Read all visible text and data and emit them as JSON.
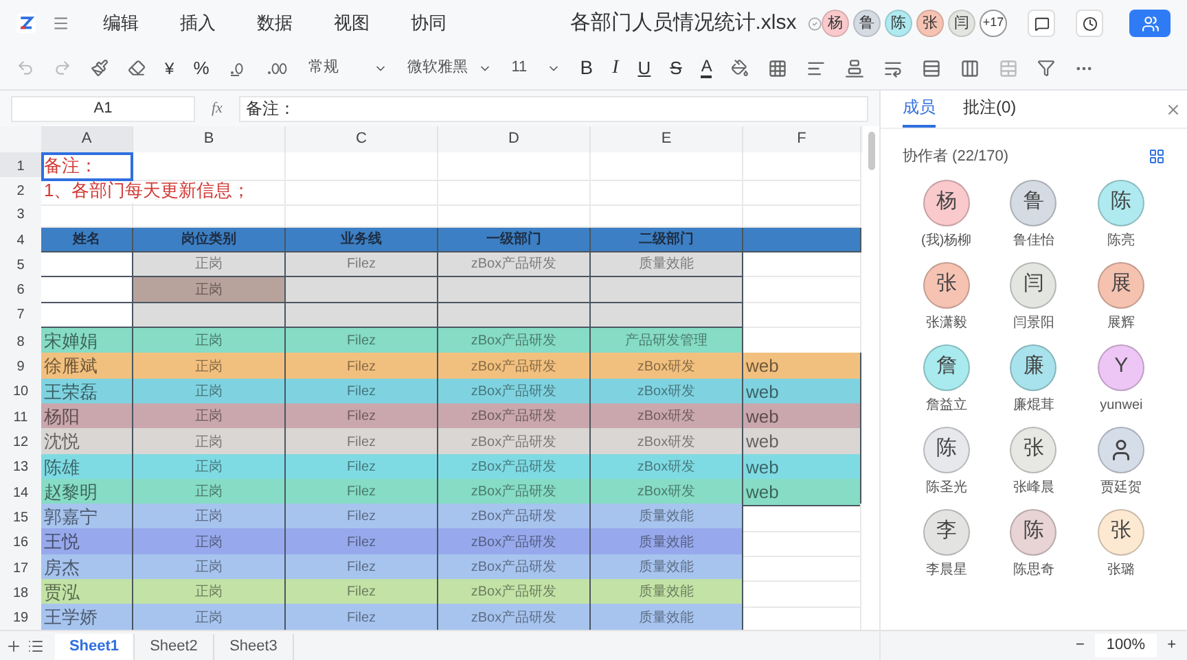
{
  "menu": [
    "编辑",
    "插入",
    "数据",
    "视图",
    "协同"
  ],
  "title": "各部门人员情况统计.xlsx",
  "top_avatars": [
    {
      "char": "杨",
      "color": "#f9c9cc"
    },
    {
      "char": "鲁",
      "color": "#d5dbe3"
    },
    {
      "char": "陈",
      "color": "#aeeaf0"
    },
    {
      "char": "张",
      "color": "#f6c3b3"
    },
    {
      "char": "闫",
      "color": "#e3e5e1"
    }
  ],
  "more_count": "+17",
  "toolbar": {
    "currency": "¥",
    "percent": "%",
    "number_format": "常规",
    "font": "微软雅黑",
    "size": "11",
    "bold": "B",
    "italic": "I",
    "underline": "U",
    "strike": "S",
    "font_color": "A"
  },
  "formula_bar": {
    "cell": "A1",
    "fx": "fx",
    "value": "备注："
  },
  "columns": [
    "A",
    "B",
    "C",
    "D",
    "E",
    "F"
  ],
  "rows": [
    {
      "number": "1",
      "kind": "note",
      "cells": [
        {
          "text": "备注：",
          "selected": true
        },
        {},
        {},
        {},
        {},
        {}
      ]
    },
    {
      "number": "2",
      "kind": "note",
      "cells": [
        {
          "text": "1、各部门每天更新信息；",
          "selected": false
        },
        {},
        {},
        {},
        {}
      ]
    },
    {
      "number": "3",
      "kind": "blank",
      "cells": [
        {},
        {},
        {},
        {},
        {},
        {}
      ]
    },
    {
      "number": "4",
      "kind": "header",
      "cells": [
        {
          "text": "姓名",
          "color": "#3d7fc4"
        },
        {
          "text": "岗位类别",
          "color": "#3d7fc4"
        },
        {
          "text": "业务线",
          "color": "#3d7fc4"
        },
        {
          "text": "一级部门",
          "color": "#3d7fc4"
        },
        {
          "text": "二级部门",
          "color": "#3d7fc4"
        },
        {
          "color": "#3d7fc4"
        }
      ]
    },
    {
      "number": "5",
      "kind": "data",
      "cells": [
        {},
        {
          "text": "正岗",
          "color": "#dcdcdc"
        },
        {
          "text": "Filez",
          "color": "#dcdcdc"
        },
        {
          "text": "zBox产品研发",
          "color": "#dcdcdc"
        },
        {
          "text": "质量效能",
          "color": "#dcdcdc"
        },
        {}
      ]
    },
    {
      "number": "6",
      "kind": "data",
      "cells": [
        {},
        {
          "text": "正岗",
          "color": "#b8a39c"
        },
        {
          "color": "#dcdcdc"
        },
        {
          "color": "#dcdcdc"
        },
        {
          "color": "#dcdcdc"
        },
        {}
      ]
    },
    {
      "number": "7",
      "kind": "data",
      "cells": [
        {},
        {
          "color": "#dcdcdc"
        },
        {
          "color": "#dcdcdc"
        },
        {
          "color": "#dcdcdc"
        },
        {
          "color": "#dcdcdc"
        },
        {}
      ]
    },
    {
      "number": "8",
      "kind": "data",
      "cells": [
        {
          "text": "宋婵娟",
          "color": "#86dcc4"
        },
        {
          "text": "正岗",
          "color": "#86dcc4"
        },
        {
          "text": "Filez",
          "color": "#86dcc4"
        },
        {
          "text": "zBox产品研发",
          "color": "#86dcc4"
        },
        {
          "text": "产品研发管理",
          "color": "#86dcc4"
        },
        {}
      ]
    },
    {
      "number": "9",
      "kind": "data",
      "cells": [
        {
          "text": "徐雁斌",
          "color": "#f2c07e"
        },
        {
          "text": "正岗",
          "color": "#f2c07e"
        },
        {
          "text": "Filez",
          "color": "#f2c07e"
        },
        {
          "text": "zBox产品研发",
          "color": "#f2c07e"
        },
        {
          "text": "zBox研发",
          "color": "#f2c07e"
        },
        {
          "text": "web",
          "color": "#f2c07e"
        }
      ]
    },
    {
      "number": "10",
      "kind": "data",
      "cells": [
        {
          "text": "王荣磊",
          "color": "#7fd3e0"
        },
        {
          "text": "正岗",
          "color": "#7fd3e0"
        },
        {
          "text": "Filez",
          "color": "#7fd3e0"
        },
        {
          "text": "zBox产品研发",
          "color": "#7fd3e0"
        },
        {
          "text": "zBox研发",
          "color": "#7fd3e0"
        },
        {
          "text": "web",
          "color": "#7fd3e0"
        }
      ]
    },
    {
      "number": "11",
      "kind": "data",
      "cells": [
        {
          "text": "杨阳",
          "color": "#c9a7ad"
        },
        {
          "text": "正岗",
          "color": "#c9a7ad"
        },
        {
          "text": "Filez",
          "color": "#c9a7ad"
        },
        {
          "text": "zBox产品研发",
          "color": "#c9a7ad"
        },
        {
          "text": "zBox研发",
          "color": "#c9a7ad"
        },
        {
          "text": "web",
          "color": "#c9a7ad"
        }
      ]
    },
    {
      "number": "12",
      "kind": "data",
      "cells": [
        {
          "text": "沈悦",
          "color": "#d9d6d3"
        },
        {
          "text": "正岗",
          "color": "#d9d6d3"
        },
        {
          "text": "Filez",
          "color": "#d9d6d3"
        },
        {
          "text": "zBox产品研发",
          "color": "#d9d6d3"
        },
        {
          "text": "zBox研发",
          "color": "#d9d6d3"
        },
        {
          "text": "web",
          "color": "#d9d6d3"
        }
      ]
    },
    {
      "number": "13",
      "kind": "data",
      "cells": [
        {
          "text": "陈雄",
          "color": "#7fdbe3"
        },
        {
          "text": "正岗",
          "color": "#7fdbe3"
        },
        {
          "text": "Filez",
          "color": "#7fdbe3"
        },
        {
          "text": "zBox产品研发",
          "color": "#7fdbe3"
        },
        {
          "text": "zBox研发",
          "color": "#7fdbe3"
        },
        {
          "text": "web",
          "color": "#7fdbe3"
        }
      ]
    },
    {
      "number": "14",
      "kind": "data",
      "cells": [
        {
          "text": "赵黎明",
          "color": "#86dcc4"
        },
        {
          "text": "正岗",
          "color": "#86dcc4"
        },
        {
          "text": "Filez",
          "color": "#86dcc4"
        },
        {
          "text": "zBox产品研发",
          "color": "#86dcc4"
        },
        {
          "text": "zBox研发",
          "color": "#86dcc4"
        },
        {
          "text": "web",
          "color": "#86dcc4"
        }
      ]
    },
    {
      "number": "15",
      "kind": "data",
      "cells": [
        {
          "text": "郭嘉宁",
          "color": "#a7c4ef"
        },
        {
          "text": "正岗",
          "color": "#a7c4ef"
        },
        {
          "text": "Filez",
          "color": "#a7c4ef"
        },
        {
          "text": "zBox产品研发",
          "color": "#a7c4ef"
        },
        {
          "text": "质量效能",
          "color": "#a7c4ef"
        },
        {}
      ]
    },
    {
      "number": "16",
      "kind": "data",
      "cells": [
        {
          "text": "王悦",
          "color": "#97a9ec"
        },
        {
          "text": "正岗",
          "color": "#97a9ec"
        },
        {
          "text": "Filez",
          "color": "#97a9ec"
        },
        {
          "text": "zBox产品研发",
          "color": "#97a9ec"
        },
        {
          "text": "质量效能",
          "color": "#97a9ec"
        },
        {}
      ]
    },
    {
      "number": "17",
      "kind": "data",
      "cells": [
        {
          "text": "房杰",
          "color": "#a7c4ef"
        },
        {
          "text": "正岗",
          "color": "#a7c4ef"
        },
        {
          "text": "Filez",
          "color": "#a7c4ef"
        },
        {
          "text": "zBox产品研发",
          "color": "#a7c4ef"
        },
        {
          "text": "质量效能",
          "color": "#a7c4ef"
        },
        {}
      ]
    },
    {
      "number": "18",
      "kind": "data",
      "cells": [
        {
          "text": "贾泓",
          "color": "#c2e2a6"
        },
        {
          "text": "正岗",
          "color": "#c2e2a6"
        },
        {
          "text": "Filez",
          "color": "#c2e2a6"
        },
        {
          "text": "zBox产品研发",
          "color": "#c2e2a6"
        },
        {
          "text": "质量效能",
          "color": "#c2e2a6"
        },
        {}
      ]
    },
    {
      "number": "19",
      "kind": "data",
      "cells": [
        {
          "text": "王学娇",
          "color": "#a7c4ef"
        },
        {
          "text": "正岗",
          "color": "#a7c4ef"
        },
        {
          "text": "Filez",
          "color": "#a7c4ef"
        },
        {
          "text": "zBox产品研发",
          "color": "#a7c4ef"
        },
        {
          "text": "质量效能",
          "color": "#a7c4ef"
        },
        {}
      ]
    }
  ],
  "sheet_tabs": [
    {
      "label": "Sheet1",
      "selected": true
    },
    {
      "label": "Sheet2",
      "selected": false
    },
    {
      "label": "Sheet3",
      "selected": false
    }
  ],
  "zoom": {
    "minus": "−",
    "value": "100%",
    "plus": "+"
  },
  "panel": {
    "tabs": [
      {
        "label": "成员",
        "selected": true
      },
      {
        "label": "批注(0)",
        "selected": false
      }
    ],
    "heading": "协作者 (22/170)",
    "members": [
      {
        "kind": "char",
        "char": "杨",
        "name": "(我)杨柳",
        "color": "#f9c9cc"
      },
      {
        "kind": "char",
        "char": "鲁",
        "name": "鲁佳怡",
        "color": "#d5dbe3"
      },
      {
        "kind": "char",
        "char": "陈",
        "name": "陈亮",
        "color": "#aeeaf0"
      },
      {
        "kind": "char",
        "char": "张",
        "name": "张潇毅",
        "color": "#f6c3b3"
      },
      {
        "kind": "char",
        "char": "闫",
        "name": "闫景阳",
        "color": "#e3e5e1"
      },
      {
        "kind": "char",
        "char": "展",
        "name": "展辉",
        "color": "#f5c2b0"
      },
      {
        "kind": "char",
        "char": "詹",
        "name": "詹益立",
        "color": "#a8eaee"
      },
      {
        "kind": "char",
        "char": "廉",
        "name": "廉焜茸",
        "color": "#a8e2ec"
      },
      {
        "kind": "char",
        "char": "Y",
        "name": "yunwei",
        "color": "#eec6f5"
      },
      {
        "kind": "char",
        "char": "陈",
        "name": "陈圣光",
        "color": "#e6e8ec"
      },
      {
        "kind": "char",
        "char": "张",
        "name": "张峰晨",
        "color": "#e7e7e3"
      },
      {
        "kind": "icon",
        "name": "贾廷贺",
        "color": "#d5dde8"
      },
      {
        "kind": "char",
        "char": "李",
        "name": "李晨星",
        "color": "#e3e3e1"
      },
      {
        "kind": "char",
        "char": "陈",
        "name": "陈思奇",
        "color": "#e8d3d5"
      },
      {
        "kind": "char",
        "char": "张",
        "name": "张璐",
        "color": "#fde9d2"
      }
    ]
  }
}
